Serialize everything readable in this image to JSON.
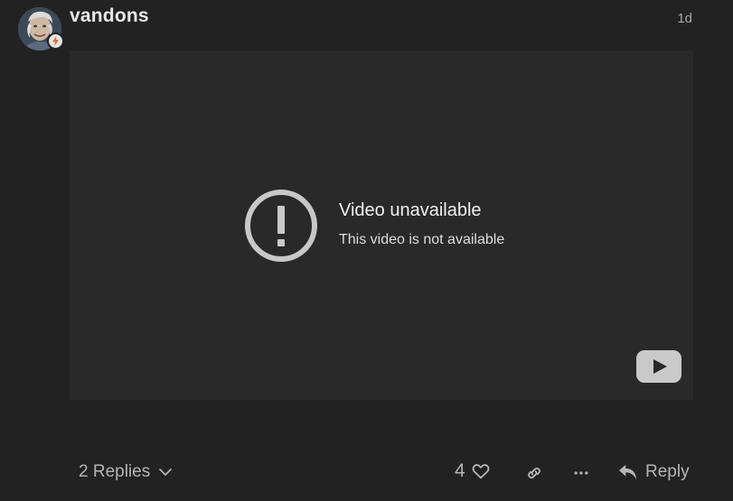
{
  "post": {
    "username": "vandons",
    "date": "1d",
    "avatar_icon": "user-avatar",
    "badge_icon": "lightning-icon",
    "badge_color": "#f06a2b"
  },
  "video": {
    "error_title": "Video unavailable",
    "error_message": "This video is not available",
    "error_icon": "warning-circle-icon",
    "logo_icon": "youtube-play-icon",
    "background": "#292929"
  },
  "footer": {
    "replies_label": "2 Replies",
    "replies_icon": "chevron-down-icon",
    "like_count": "4",
    "like_icon": "heart-icon",
    "link_icon": "link-icon",
    "more_icon": "ellipsis-icon",
    "reply_label": "Reply",
    "reply_icon": "reply-arrow-icon"
  }
}
